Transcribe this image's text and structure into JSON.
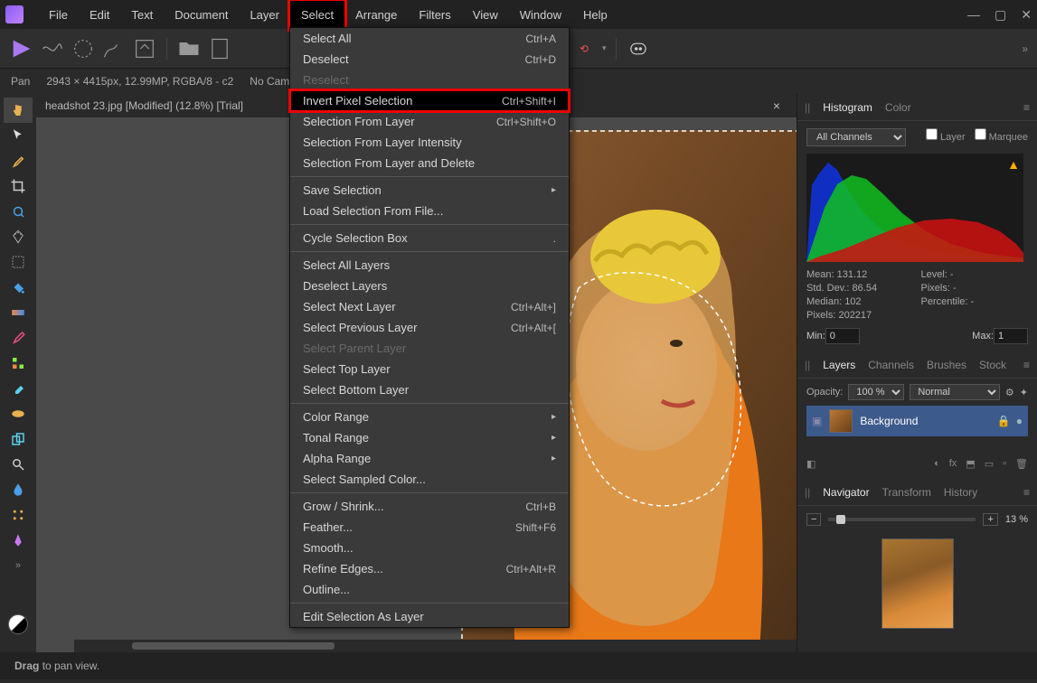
{
  "menubar": [
    "File",
    "Edit",
    "Text",
    "Document",
    "Layer",
    "Select",
    "Arrange",
    "Filters",
    "View",
    "Window",
    "Help"
  ],
  "active_menu_index": 5,
  "contextbar": {
    "tool": "Pan",
    "info": "2943 × 4415px, 12.99MP, RGBA/8 - c2",
    "camera": "No Camera"
  },
  "tab": {
    "title": "headshot 23.jpg [Modified] (12.8%) [Trial]"
  },
  "dropdown": [
    {
      "label": "Select All",
      "shortcut": "Ctrl+A"
    },
    {
      "label": "Deselect",
      "shortcut": "Ctrl+D"
    },
    {
      "label": "Reselect",
      "disabled": true
    },
    {
      "label": "Invert Pixel Selection",
      "shortcut": "Ctrl+Shift+I",
      "highlight": true
    },
    {
      "label": "Selection From Layer",
      "shortcut": "Ctrl+Shift+O"
    },
    {
      "label": "Selection From Layer Intensity"
    },
    {
      "label": "Selection From Layer and Delete"
    },
    {
      "sep": true
    },
    {
      "label": "Save Selection",
      "submenu": true
    },
    {
      "label": "Load Selection From File..."
    },
    {
      "sep": true
    },
    {
      "label": "Cycle Selection Box",
      "shortcut": "."
    },
    {
      "sep": true
    },
    {
      "label": "Select All Layers"
    },
    {
      "label": "Deselect Layers"
    },
    {
      "label": "Select Next Layer",
      "shortcut": "Ctrl+Alt+]"
    },
    {
      "label": "Select Previous Layer",
      "shortcut": "Ctrl+Alt+["
    },
    {
      "label": "Select Parent Layer",
      "disabled": true
    },
    {
      "label": "Select Top Layer"
    },
    {
      "label": "Select Bottom Layer"
    },
    {
      "sep": true
    },
    {
      "label": "Color Range",
      "submenu": true
    },
    {
      "label": "Tonal Range",
      "submenu": true
    },
    {
      "label": "Alpha Range",
      "submenu": true
    },
    {
      "label": "Select Sampled Color..."
    },
    {
      "sep": true
    },
    {
      "label": "Grow / Shrink...",
      "shortcut": "Ctrl+B"
    },
    {
      "label": "Feather...",
      "shortcut": "Shift+F6"
    },
    {
      "label": "Smooth..."
    },
    {
      "label": "Refine Edges...",
      "shortcut": "Ctrl+Alt+R"
    },
    {
      "label": "Outline..."
    },
    {
      "sep": true
    },
    {
      "label": "Edit Selection As Layer"
    }
  ],
  "histogram": {
    "tabs": [
      "Histogram",
      "Color"
    ],
    "channel": "All Channels",
    "checks": [
      "Layer",
      "Marquee"
    ],
    "stats": {
      "mean": "Mean: 131.12",
      "sd": "Std. Dev.: 86.54",
      "median": "Median: 102",
      "pixels": "Pixels: 202217",
      "level": "Level: -",
      "px": "Pixels: -",
      "pct": "Percentile: -"
    },
    "min_label": "Min:",
    "min": "0",
    "max_label": "Max:",
    "max": "1"
  },
  "layers": {
    "tabs": [
      "Layers",
      "Channels",
      "Brushes",
      "Stock"
    ],
    "opacity_label": "Opacity:",
    "opacity": "100 %",
    "blend": "Normal",
    "items": [
      {
        "name": "Background"
      }
    ]
  },
  "navigator": {
    "tabs": [
      "Navigator",
      "Transform",
      "History"
    ],
    "zoom": "13 %"
  },
  "statusbar": {
    "hint": "Drag to pan view."
  }
}
